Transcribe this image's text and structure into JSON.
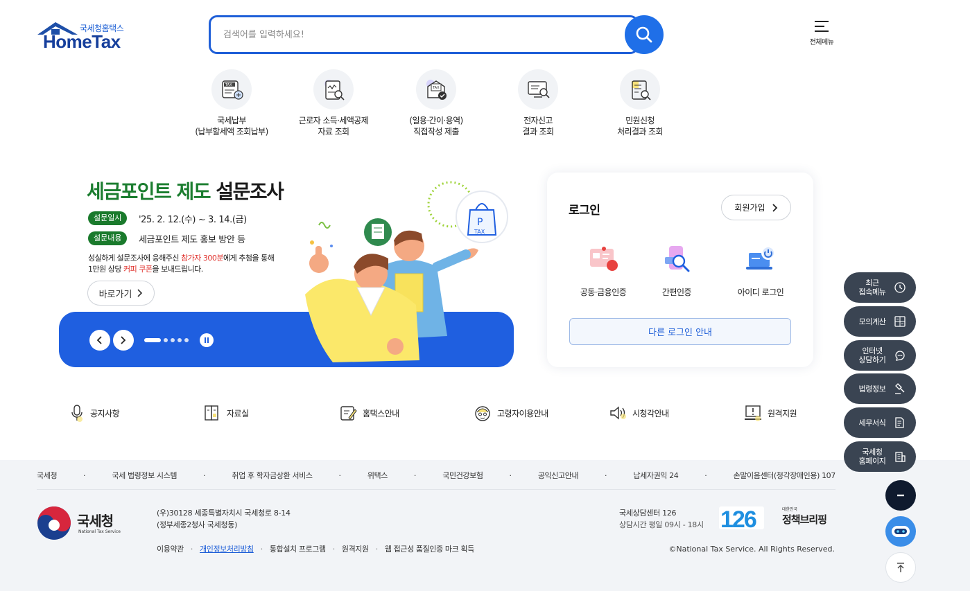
{
  "header": {
    "logo_sub": "국세청홈택스",
    "logo_main": "HomeTax",
    "search_placeholder": "검색어를 입력하세요!",
    "all_menu_label": "전체메뉴"
  },
  "quick_menu": [
    {
      "line1": "국세납부",
      "line2": "(납부할세액 조회납부)",
      "icon": "tax-payment-icon"
    },
    {
      "line1": "근로자 소득·세액공제",
      "line2": "자료 조회",
      "icon": "deduction-search-icon"
    },
    {
      "line1": "(일용·간이·용역)",
      "line2": "직접작성 제출",
      "icon": "tax-document-check-icon"
    },
    {
      "line1": "전자신고",
      "line2": "결과 조회",
      "icon": "e-filing-search-icon"
    },
    {
      "line1": "민원신청",
      "line2": "처리결과 조회",
      "icon": "civil-petition-search-icon"
    }
  ],
  "banner": {
    "title_green": "세금포인트 제도",
    "title_black": "설문조사",
    "pill1": "설문일시",
    "pill1_text": "'25. 2. 12.(수) ~ 3. 14.(금)",
    "pill2": "설문내용",
    "pill2_text": "세금포인트 제도 홍보 방안 등",
    "desc1_a": "성실하게 설문조사에 응해주신 ",
    "desc1_red": "참가자 300분",
    "desc1_b": "에게 추첨을 통해",
    "desc2_a": "1만원 상당 ",
    "desc2_red": "커피 쿠폰",
    "desc2_b": "을 보내드립니다.",
    "goto_label": "바로가기",
    "slide_count": 5,
    "active_slide": 1
  },
  "login": {
    "title": "로그인",
    "join_label": "회원가입",
    "options": [
      "공동·금융인증",
      "간편인증",
      "아이디 로그인"
    ],
    "other_label": "다른 로그인 안내"
  },
  "bottom_links": [
    {
      "label": "공지사항",
      "icon": "microphone-icon"
    },
    {
      "label": "자료실",
      "icon": "archive-icon"
    },
    {
      "label": "홈택스안내",
      "icon": "guide-edit-icon"
    },
    {
      "label": "고령자이용안내",
      "icon": "senior-icon"
    },
    {
      "label": "시청각안내",
      "icon": "speaker-icon"
    },
    {
      "label": "원격지원",
      "icon": "remote-support-icon"
    }
  ],
  "footer": {
    "links_row": [
      "국세청",
      "국세 법령정보 시스템",
      "취업 후 학자금상환 서비스",
      "위택스",
      "국민건강보험",
      "공익신고안내",
      "납세자권익 24",
      "손말이음센터(청각장애인용) 107"
    ],
    "nts_name": "국세청",
    "nts_en": "National Tax Service",
    "address1": "(우)30128 세종특별자치시 국세청로 8-14",
    "address2": "(정부세종2청사 국세청동)",
    "policy_links": [
      "이용약관",
      "개인정보처리방침",
      "통합설치 프로그램",
      "원격지원",
      "웹 접근성 품질인증 마크 획득"
    ],
    "center_name": "국세상담센터 126",
    "center_hours": "상담시간 평일 09시 - 18시",
    "call_number": "126",
    "briefing_small": "대한민국",
    "briefing_big": "정책브리핑",
    "copyright": "©National Tax Service. All Rights Reserved."
  },
  "floating": [
    {
      "label": "최근\n접속메뉴",
      "icon": "clock-icon"
    },
    {
      "label": "모의계산",
      "icon": "calculator-icon"
    },
    {
      "label": "인터넷\n상담하기",
      "icon": "chat-consult-icon"
    },
    {
      "label": "법령정보",
      "icon": "gavel-icon"
    },
    {
      "label": "세무서식",
      "icon": "form-document-icon"
    },
    {
      "label": "국세청\n홈페이지",
      "icon": "building-icon"
    }
  ],
  "colors": {
    "primary_blue": "#1f5fe0",
    "dark_green": "#1b7d2f",
    "floating_bg": "#3a4452",
    "footer_bg": "#f2f4f7"
  }
}
